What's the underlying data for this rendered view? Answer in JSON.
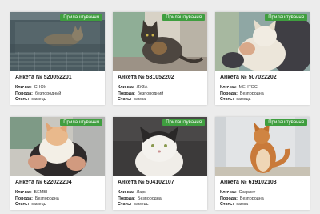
{
  "labels": {
    "name": "Кличка:",
    "breed": "Порода:",
    "sex": "Стать:"
  },
  "badge_color": "#3f9e3f",
  "cards": [
    {
      "badge": "Прилаштування",
      "title": "Анкета № 520052201",
      "name": "СНОУ",
      "breed": "безпородний",
      "sex": "самець"
    },
    {
      "badge": "Прилаштування",
      "title": "Анкета № 531052202",
      "name": "ЛУЗА",
      "breed": "безпородний",
      "sex": "самка"
    },
    {
      "badge": "Прилаштування",
      "title": "Анкета № 507022202",
      "name": "МЕНТОС",
      "breed": "Безпородна",
      "sex": "самець"
    },
    {
      "badge": "Прилаштування",
      "title": "Анкета № 622022204",
      "name": "БЕМБІ",
      "breed": "Безпородна",
      "sex": "самець"
    },
    {
      "badge": "Прилаштування",
      "title": "Анкета № 504102107",
      "name": "Ларк",
      "breed": "Безпородна",
      "sex": "самець"
    },
    {
      "badge": "Прилаштування",
      "title": "Анкета № 619102103",
      "name": "Скарлет",
      "breed": "Безпородна",
      "sex": "самка"
    }
  ]
}
